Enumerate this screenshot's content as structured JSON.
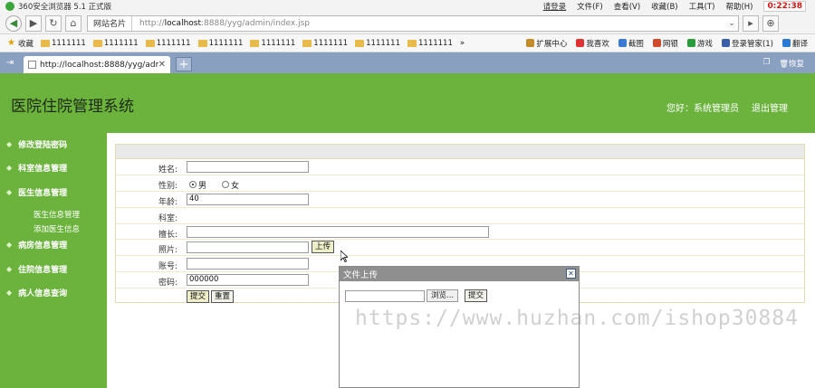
{
  "browser": {
    "title": "360安全浏览器 5.1 正式版",
    "login": "请登录",
    "menu": [
      "文件(F)",
      "查看(V)",
      "收藏(B)",
      "工具(T)",
      "帮助(H)"
    ],
    "clock": "0:22:38",
    "site_card": "网站名片",
    "url_prefix": "http://",
    "url_host": "localhost",
    "url_rest": ":8888/yyg/admin/index.jsp",
    "favorites_label": "收藏",
    "favorites": [
      "1111111",
      "1111111",
      "1111111",
      "1111111",
      "1111111",
      "1111111",
      "1111111",
      "1111111"
    ],
    "tools": [
      "扩展中心",
      "我喜欢",
      "截图",
      "网银",
      "游戏",
      "登录管家(1)",
      "翻译"
    ],
    "tab_title": "http://localhost:8888/yyg/admin...",
    "tab_right": [
      "恢复"
    ]
  },
  "page": {
    "app_title": "医院住院管理系统",
    "welcome": "您好：系统管理员",
    "logout": "退出管理",
    "sidebar": {
      "items": [
        "修改登陆密码",
        "科室信息管理",
        "医生信息管理",
        "病房信息管理",
        "住院信息管理",
        "病人信息查询"
      ],
      "subitems": [
        "医生信息管理",
        "添加医生信息"
      ]
    },
    "form": {
      "labels": {
        "name": "姓名:",
        "gender": "性别:",
        "age": "年龄:",
        "dept": "科室:",
        "specialty": "擅长:",
        "photo": "照片:",
        "account": "账号:",
        "password": "密码:"
      },
      "gender_male": "男",
      "gender_female": "女",
      "age_value": "40",
      "password_value": "000000",
      "upload_button": "上传",
      "submit_button": "提交",
      "reset_button": "重置"
    },
    "dialog": {
      "title": "文件上传",
      "browse_button": "浏览...",
      "submit_button": "提交"
    },
    "watermark": "https://www.huzhan.com/ishop30884"
  }
}
